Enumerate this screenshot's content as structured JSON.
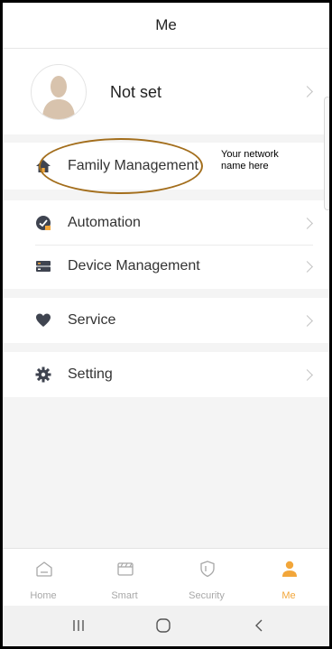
{
  "header": {
    "title": "Me"
  },
  "profile": {
    "name": "Not set"
  },
  "callout": {
    "line1": "Your network",
    "line2": "name here"
  },
  "menu": {
    "family": {
      "label": "Family Management"
    },
    "automation": {
      "label": "Automation"
    },
    "device": {
      "label": "Device Management"
    },
    "service": {
      "label": "Service"
    },
    "setting": {
      "label": "Setting"
    }
  },
  "tabs": [
    {
      "label": "Home",
      "icon": "home-icon"
    },
    {
      "label": "Smart",
      "icon": "smart-icon"
    },
    {
      "label": "Security",
      "icon": "shield-icon"
    },
    {
      "label": "Me",
      "icon": "person-icon",
      "active": true
    }
  ],
  "colors": {
    "accent": "#f2a63a",
    "highlight_oval": "#a36e1c",
    "icon_dark": "#3f4450"
  }
}
